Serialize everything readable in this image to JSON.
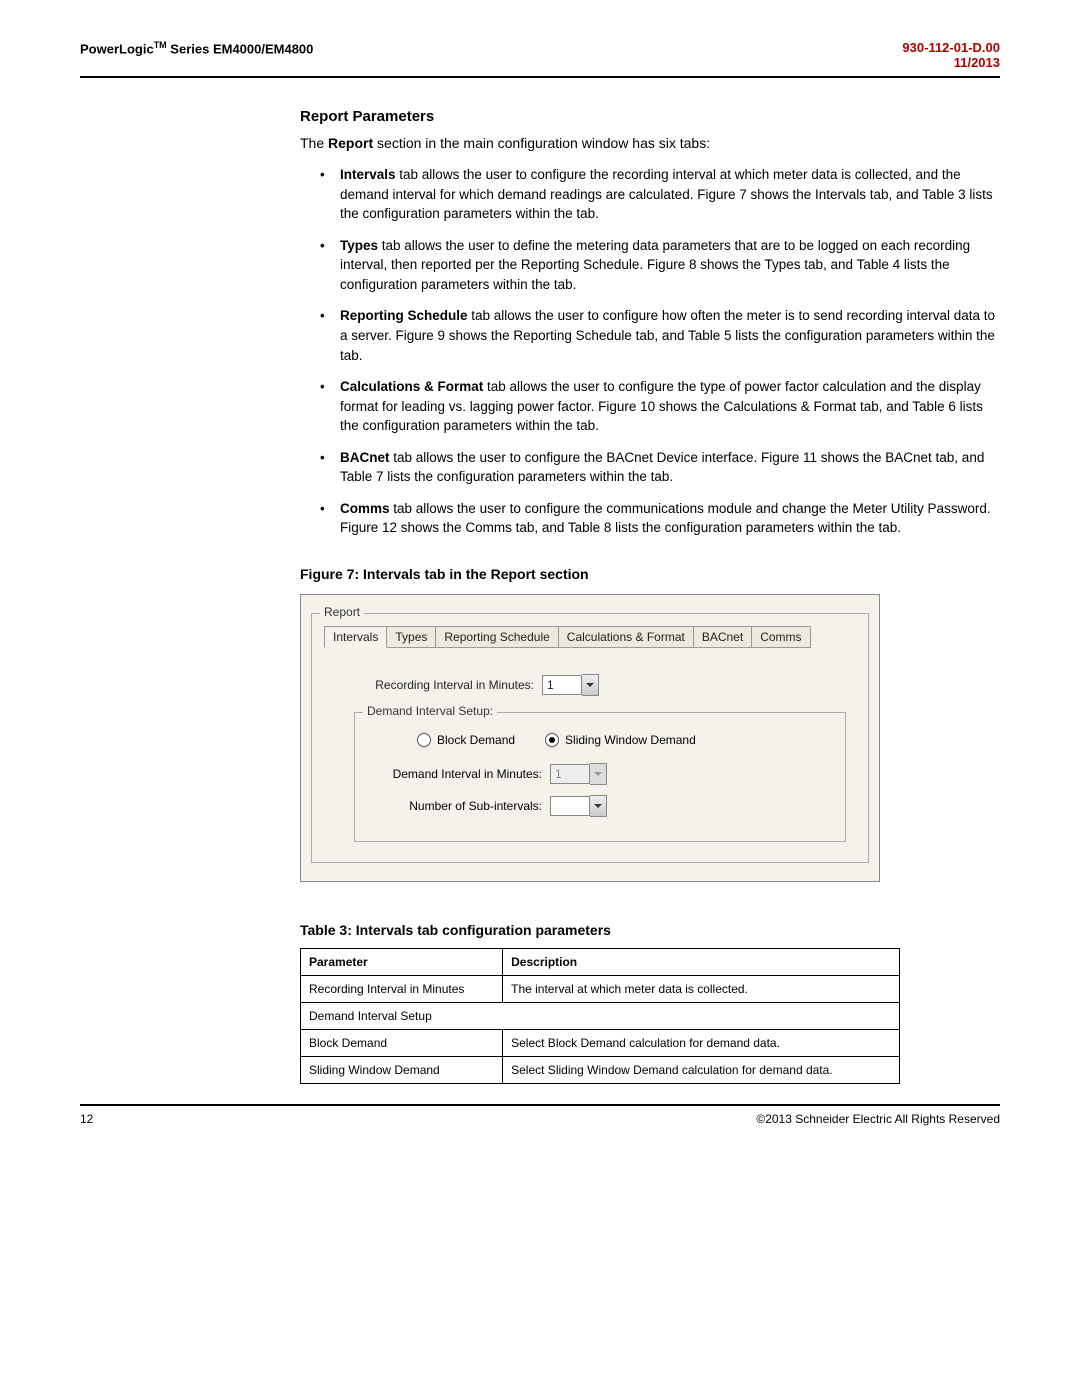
{
  "header": {
    "left_prefix": "PowerLogic",
    "left_tm": "TM",
    "left_suffix": " Series EM4000/EM4800",
    "right_code": "930-112-01-D.00",
    "right_date": "11/2013"
  },
  "section": {
    "title": "Report Parameters",
    "intro_prefix": "The ",
    "intro_bold": "Report",
    "intro_suffix": " section in the main configuration window has six tabs:"
  },
  "bullets": [
    {
      "bold": "Intervals",
      "text": " tab allows the user to configure the recording interval at which meter data is collected, and the demand interval for which demand readings are calculated. Figure 7 shows the Intervals tab, and Table 3 lists the configuration parameters within the tab."
    },
    {
      "bold": "Types",
      "text": " tab allows the user to define the metering data parameters that are to be logged on each recording interval, then reported per the Reporting Schedule. Figure 8 shows the Types tab, and Table 4 lists the configuration parameters within the tab."
    },
    {
      "bold": "Reporting Schedule",
      "text": " tab allows the user to configure how often the meter is to send recording interval data to a server. Figure 9 shows the Reporting Schedule tab, and Table 5 lists the configuration parameters within the tab."
    },
    {
      "bold": "Calculations & Format",
      "text": " tab allows the user to configure the type of power factor calculation and the display format for leading vs. lagging power factor. Figure 10 shows the Calculations & Format tab, and Table 6 lists the configuration parameters within the tab."
    },
    {
      "bold": "BACnet",
      "text": " tab allows the user to configure the BACnet Device interface. Figure 11 shows the BACnet tab, and Table 7 lists the configuration parameters within the tab."
    },
    {
      "bold": "Comms",
      "text": " tab allows the user to configure the communications module and change the Meter Utility Password. Figure 12 shows the Comms tab, and Table 8 lists the configuration parameters within the tab."
    }
  ],
  "figure": {
    "caption": "Figure 7:  Intervals tab in the Report section",
    "group_label": "Report",
    "tabs": [
      "Intervals",
      "Types",
      "Reporting Schedule",
      "Calculations & Format",
      "BACnet",
      "Comms"
    ],
    "recording_label": "Recording Interval in Minutes:",
    "recording_value": "1",
    "demand_group": "Demand Interval Setup:",
    "radio_block": "Block Demand",
    "radio_sliding": "Sliding Window Demand",
    "demand_interval_label": "Demand Interval in Minutes:",
    "demand_interval_value": "1",
    "sub_intervals_label": "Number of Sub-intervals:",
    "sub_intervals_value": ""
  },
  "table": {
    "caption": "Table 3:  Intervals tab configuration parameters",
    "head_param": "Parameter",
    "head_desc": "Description",
    "rows": [
      {
        "param": "Recording Interval in Minutes",
        "desc": "The interval at which meter data is collected."
      },
      {
        "param": "Demand Interval Setup",
        "desc": ""
      },
      {
        "param": "Block Demand",
        "desc": "Select Block Demand calculation for demand data."
      },
      {
        "param": "Sliding Window Demand",
        "desc": "Select Sliding Window Demand calculation for demand data."
      }
    ]
  },
  "footer": {
    "page": "12",
    "copyright": "©2013 Schneider Electric All Rights Reserved"
  }
}
